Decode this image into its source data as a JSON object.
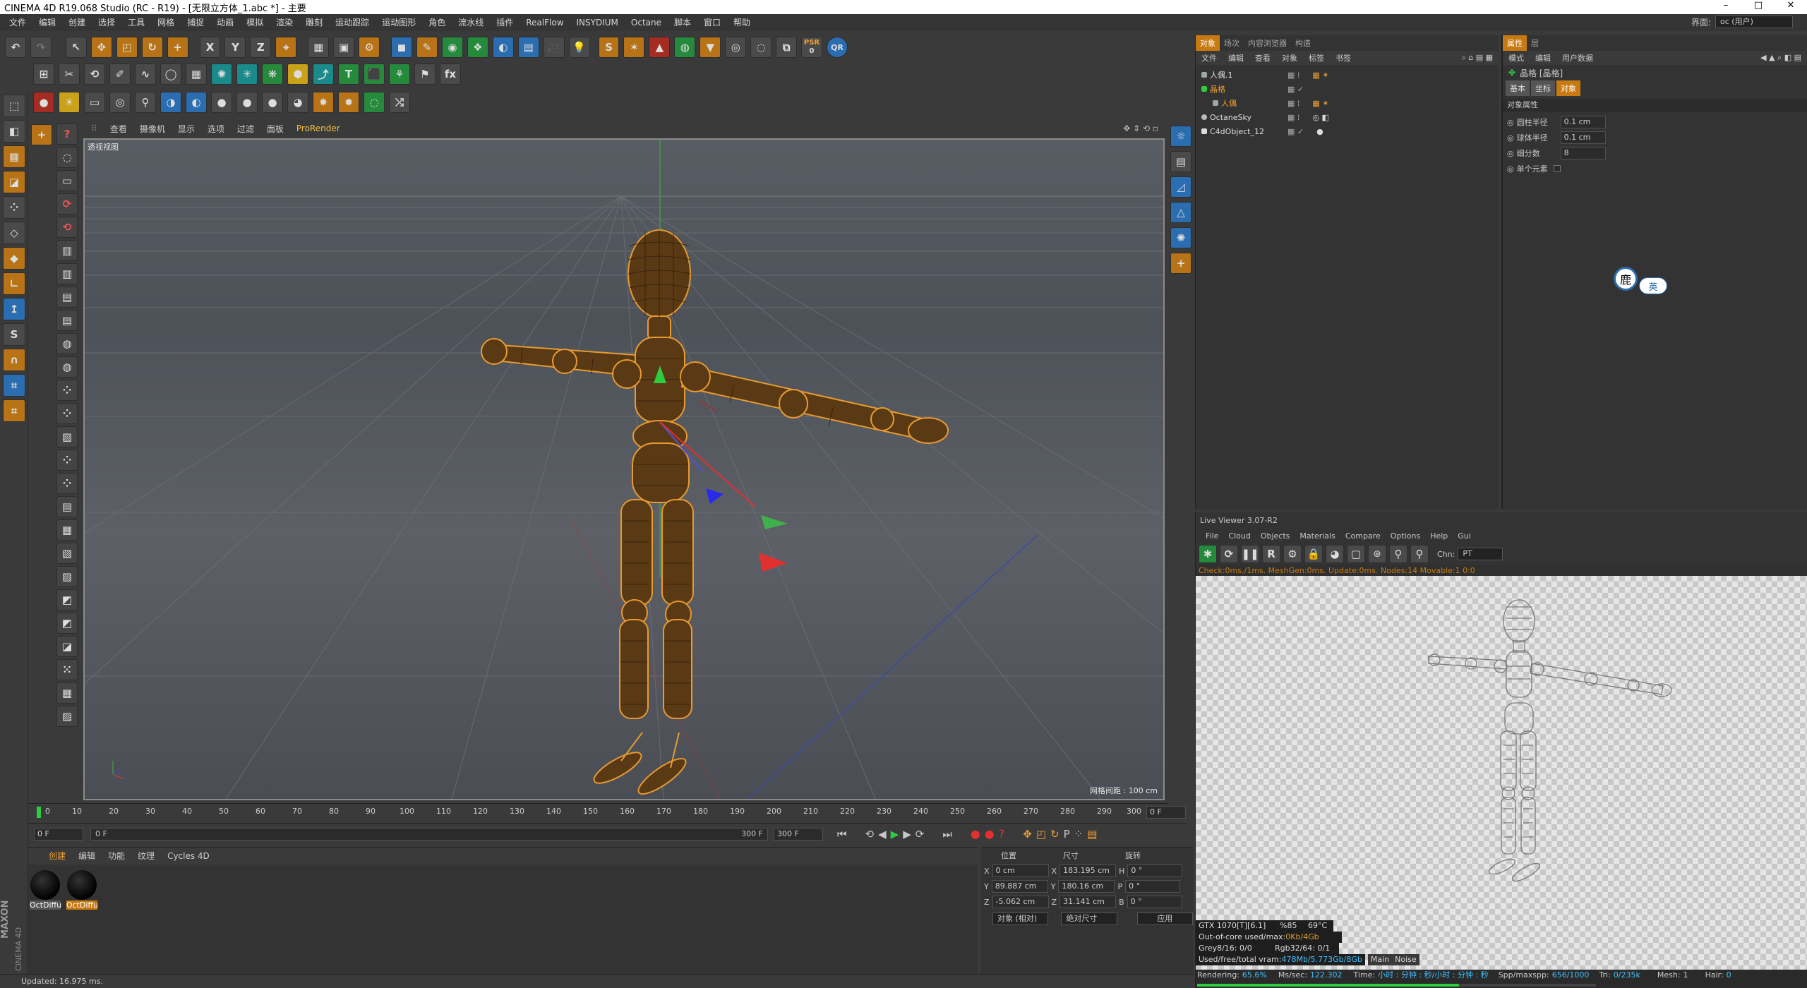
{
  "window": {
    "title": "CINEMA 4D R19.068 Studio (RC - R19) - [无限立方体_1.abc *] - 主要",
    "controls": [
      "–",
      "□",
      "✕"
    ]
  },
  "menu": {
    "items": [
      "文件",
      "编辑",
      "创建",
      "选择",
      "工具",
      "网格",
      "捕捉",
      "动画",
      "模拟",
      "渲染",
      "雕刻",
      "运动跟踪",
      "运动图形",
      "角色",
      "流水线",
      "插件",
      "RealFlow",
      "INSYDIUM",
      "Octane",
      "脚本",
      "窗口",
      "帮助"
    ],
    "interface_label": "界面:",
    "interface_value": "oc (用户)"
  },
  "toolbar": {
    "row1": [
      "undo",
      "redo",
      "select",
      "move",
      "scale",
      "rotate",
      "add",
      "X",
      "Y",
      "Z",
      "coord",
      "render-view",
      "render",
      "render-settings",
      "cube",
      "pen",
      "subdivide",
      "deform",
      "array",
      "floor",
      "camera",
      "light",
      "octane-s",
      "octane-tag",
      "octane-sphere",
      "octane-hdri",
      "octane-render",
      "octane-light",
      "PSR",
      "QR"
    ],
    "psr_label": "PSR",
    "psr_value": "0",
    "qr_label": "QR"
  },
  "viewport": {
    "menu": [
      "查看",
      "摄像机",
      "显示",
      "选项",
      "过滤",
      "面板",
      "ProRender"
    ],
    "label": "透视视图",
    "grid_scale": "网格间距 : 100 cm"
  },
  "timeline": {
    "ticks": [
      "0",
      "10",
      "20",
      "30",
      "40",
      "50",
      "60",
      "70",
      "80",
      "90",
      "100",
      "110",
      "120",
      "130",
      "140",
      "150",
      "160",
      "170",
      "180",
      "190",
      "200",
      "210",
      "220",
      "230",
      "240",
      "250",
      "260",
      "270",
      "280",
      "290",
      "300"
    ],
    "current_frame": "0 F",
    "start": "0 F",
    "range_start": "0 F",
    "range_end": "300 F",
    "end": "300 F"
  },
  "materials": {
    "tabs": [
      "创建",
      "编辑",
      "功能",
      "纹理",
      "Cycles 4D"
    ],
    "items": [
      {
        "label": "OctDiffu",
        "selected": false
      },
      {
        "label": "OctDiffu",
        "selected": true
      }
    ]
  },
  "coords": {
    "headers": [
      "位置",
      "尺寸",
      "旋转"
    ],
    "rows": [
      {
        "axis": "X",
        "pos": "0 cm",
        "saxis": "X",
        "size": "183.195 cm",
        "raxis": "H",
        "rot": "0 °"
      },
      {
        "axis": "Y",
        "pos": "89.887 cm",
        "saxis": "Y",
        "size": "180.16 cm",
        "raxis": "P",
        "rot": "0 °"
      },
      {
        "axis": "Z",
        "pos": "-5.062 cm",
        "saxis": "Z",
        "size": "31.141 cm",
        "raxis": "B",
        "rot": "0 °"
      }
    ],
    "mode": "对象 (相对)",
    "size_mode": "绝对尺寸",
    "apply": "应用"
  },
  "status": {
    "text": "Updated: 16.975 ms."
  },
  "brand": {
    "maxon": "MAXON",
    "c4d": "CINEMA 4D"
  },
  "object_manager": {
    "tabs": [
      "对象",
      "场次",
      "内容浏览器",
      "构造"
    ],
    "menu": [
      "文件",
      "编辑",
      "查看",
      "对象",
      "标签",
      "书签"
    ],
    "objects": [
      {
        "name": "人偶.1",
        "indent": 0,
        "color": "#9aa"
      },
      {
        "name": "晶格",
        "indent": 0,
        "color": "#e3a23a"
      },
      {
        "name": "人偶",
        "indent": 1,
        "color": "#e3a23a"
      },
      {
        "name": "OctaneSky",
        "indent": 0,
        "color": "#9aa"
      },
      {
        "name": "C4dObject_12",
        "indent": 0,
        "color": "#9aa"
      }
    ]
  },
  "attributes": {
    "tabs": [
      "属性",
      "层"
    ],
    "menu": [
      "模式",
      "编辑",
      "用户数据"
    ],
    "object_title": "晶格 [晶格]",
    "subtabs": [
      "基本",
      "坐标",
      "对象"
    ],
    "section": "对象属性",
    "fields": [
      {
        "label": "圆柱半径",
        "value": "0.1 cm"
      },
      {
        "label": "球体半径",
        "value": "0.1 cm"
      },
      {
        "label": "细分数",
        "value": "8"
      },
      {
        "label": "单个元素",
        "value": ""
      }
    ]
  },
  "ime": {
    "icon": "鹿",
    "lang": "英"
  },
  "live_viewer": {
    "title": "Live Viewer 3.07-R2",
    "menu": [
      "File",
      "Cloud",
      "Objects",
      "Materials",
      "Compare",
      "Options",
      "Help",
      "Gui"
    ],
    "chn_label": "Chn:",
    "chn_value": "PT",
    "log": "Check:0ms./1ms. MeshGen:0ms. Update:0ms. Nodes:14 Movable:1 0:0",
    "stats": {
      "gpu": "GTX 1070[T][6.1]",
      "gpu_load": "%85",
      "gpu_temp": "69°C",
      "ooc_label": "Out-of-core used/max:",
      "ooc_value": "0Kb/4Gb",
      "grey": "Grey8/16: 0/0",
      "rgb": "Rgb32/64: 0/1",
      "vram_label": "Used/free/total vram:",
      "vram_value": "478Mb/5.773Gb/8Gb",
      "main_tab": "Main",
      "noise_tab": "Noise"
    },
    "status": {
      "rendering_label": "Rendering:",
      "rendering_value": "65.6%",
      "mssec_label": "Ms/sec:",
      "mssec_value": "122.302",
      "time_label": "Time:",
      "time_value": "小时 : 分钟 : 秒/小时 : 分钟 : 秒",
      "spp_label": "Spp/maxspp:",
      "spp_value": "656/1000",
      "tri_label": "Tri:",
      "tri_value": "0/235k",
      "mesh_label": "Mesh:",
      "mesh_value": "1",
      "hair_label": "Hair:",
      "hair_value": "0",
      "progress": 0.656
    }
  }
}
